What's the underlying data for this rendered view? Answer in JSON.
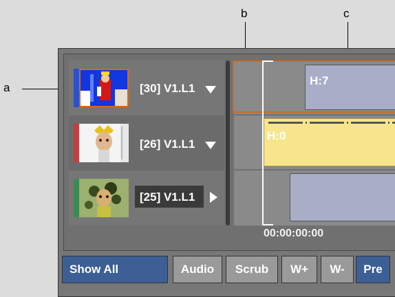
{
  "callouts": {
    "a": "a",
    "b": "b",
    "c": "c"
  },
  "tracks": [
    {
      "label": "[30] V1.L1",
      "color_bar": "#3050c8",
      "arrow": "down"
    },
    {
      "label": "[26] V1.L1",
      "color_bar": "#c04040",
      "arrow": "down"
    },
    {
      "label": "[25] V1.L1",
      "color_bar": "#3c8a55",
      "arrow": "right"
    }
  ],
  "timeline": {
    "clip1_label": "H:7",
    "clip2_label": "H:0",
    "timecode": "00:00:00:00"
  },
  "buttons": {
    "show_all": "Show All",
    "audio": "Audio",
    "scrub": "Scrub",
    "w_plus": "W+",
    "w_minus": "W-",
    "pre": "Pre"
  },
  "colors": {
    "accent_blue": "#3d5f95",
    "selection_orange": "#d2691e",
    "clip_yellow": "#f6e58d",
    "clip_lavender": "#a9adc8"
  }
}
